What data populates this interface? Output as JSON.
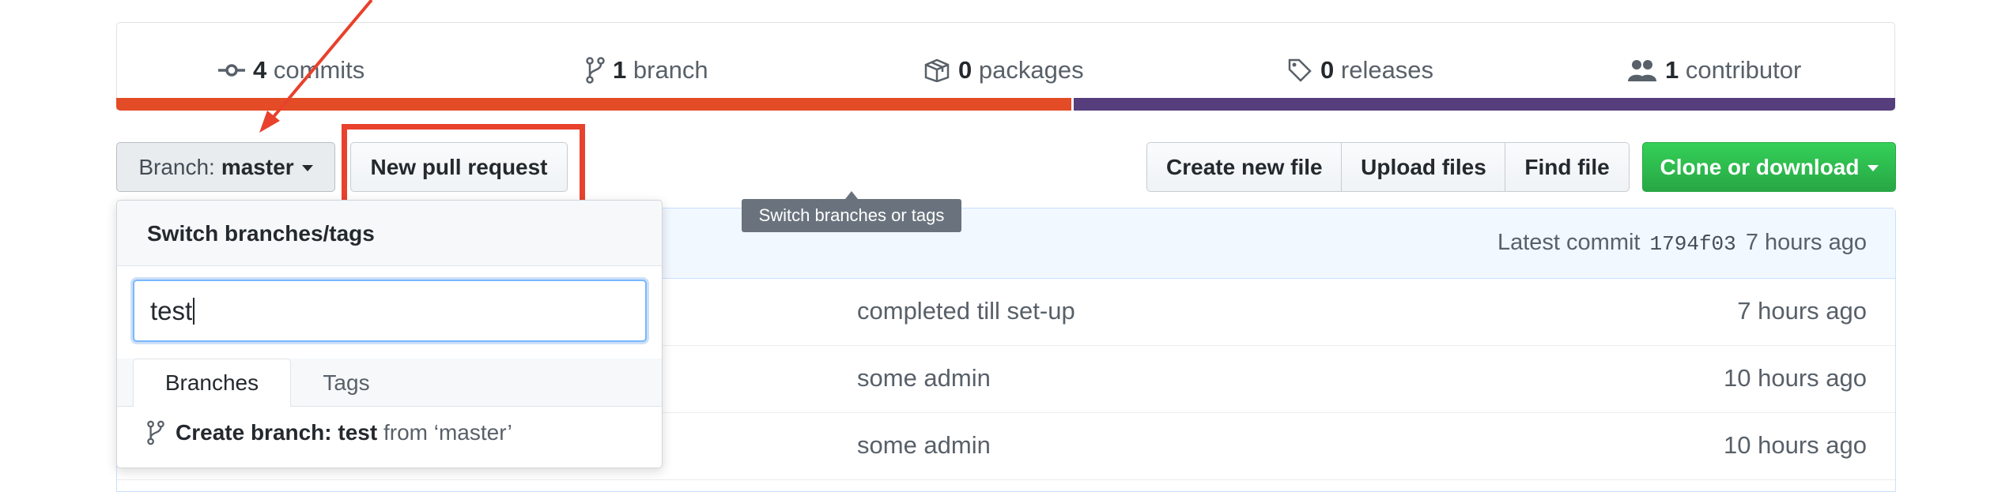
{
  "stats": {
    "commits": {
      "count": "4",
      "label": "commits",
      "icon": "commit-icon"
    },
    "branches": {
      "count": "1",
      "label": "branch",
      "icon": "branch-icon"
    },
    "packages": {
      "count": "0",
      "label": "packages",
      "icon": "package-icon"
    },
    "releases": {
      "count": "0",
      "label": "releases",
      "icon": "tag-icon"
    },
    "contributors": {
      "count": "1",
      "label": "contributor",
      "icon": "people-icon"
    }
  },
  "language_bar": {
    "colors": [
      "#e34c26",
      "#563d7c"
    ],
    "fractions": [
      0.537,
      0.463
    ]
  },
  "toolbar": {
    "branch_prefix": "Branch:",
    "branch_name": "master",
    "new_pull_request": "New pull request",
    "create_new_file": "Create new file",
    "upload_files": "Upload files",
    "find_file": "Find file",
    "clone_or_download": "Clone or download"
  },
  "tooltip": "Switch branches or tags",
  "latest_commit": {
    "label": "Latest commit",
    "sha": "1794f03",
    "age": "7 hours ago"
  },
  "files": [
    {
      "message": "completed till set-up",
      "age": "7 hours ago"
    },
    {
      "message": "some admin",
      "age": "10 hours ago"
    },
    {
      "message": "some admin",
      "age": "10 hours ago"
    }
  ],
  "branch_menu": {
    "title": "Switch branches/tags",
    "filter_value": "test",
    "tabs": [
      "Branches",
      "Tags"
    ],
    "create_prefix": "Create branch:",
    "create_name": "test",
    "create_from": "from ‘master’"
  },
  "colors": {
    "annotation": "#e8412c",
    "clone_button": "#2ea44f",
    "accent_blue": "#79b8ff"
  }
}
